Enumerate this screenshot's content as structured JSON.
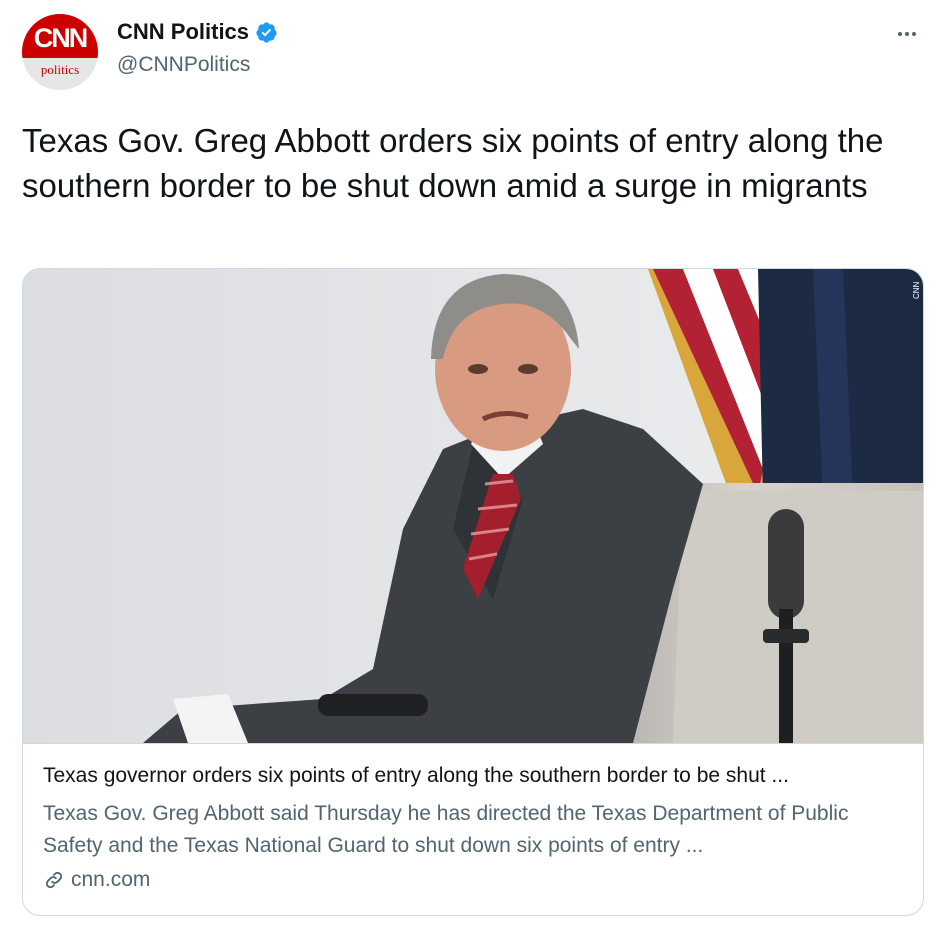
{
  "account": {
    "display_name": "CNN Politics",
    "handle": "@CNNPolitics",
    "avatar_logo_text": "CNN",
    "avatar_sub_text": "politics",
    "verified": true
  },
  "tweet": {
    "text": "Texas Gov. Greg Abbott orders six points of entry along the southern border to be shut down amid a surge in migrants"
  },
  "card": {
    "title": "Texas governor orders six points of entry along the southern border to be shut ...",
    "description": "Texas Gov. Greg Abbott said Thursday he has directed the Texas Department of Public Safety and the Texas National Guard to shut down six points of entry ...",
    "domain": "cnn.com"
  },
  "colors": {
    "text_primary": "#0f1419",
    "text_secondary": "#536471",
    "verified_badge": "#1d9bf0",
    "cnn_red": "#cc0000",
    "border": "#cfd9de"
  },
  "icons": {
    "more": "more-dots-icon",
    "verified": "verified-badge-icon",
    "link": "link-icon"
  }
}
